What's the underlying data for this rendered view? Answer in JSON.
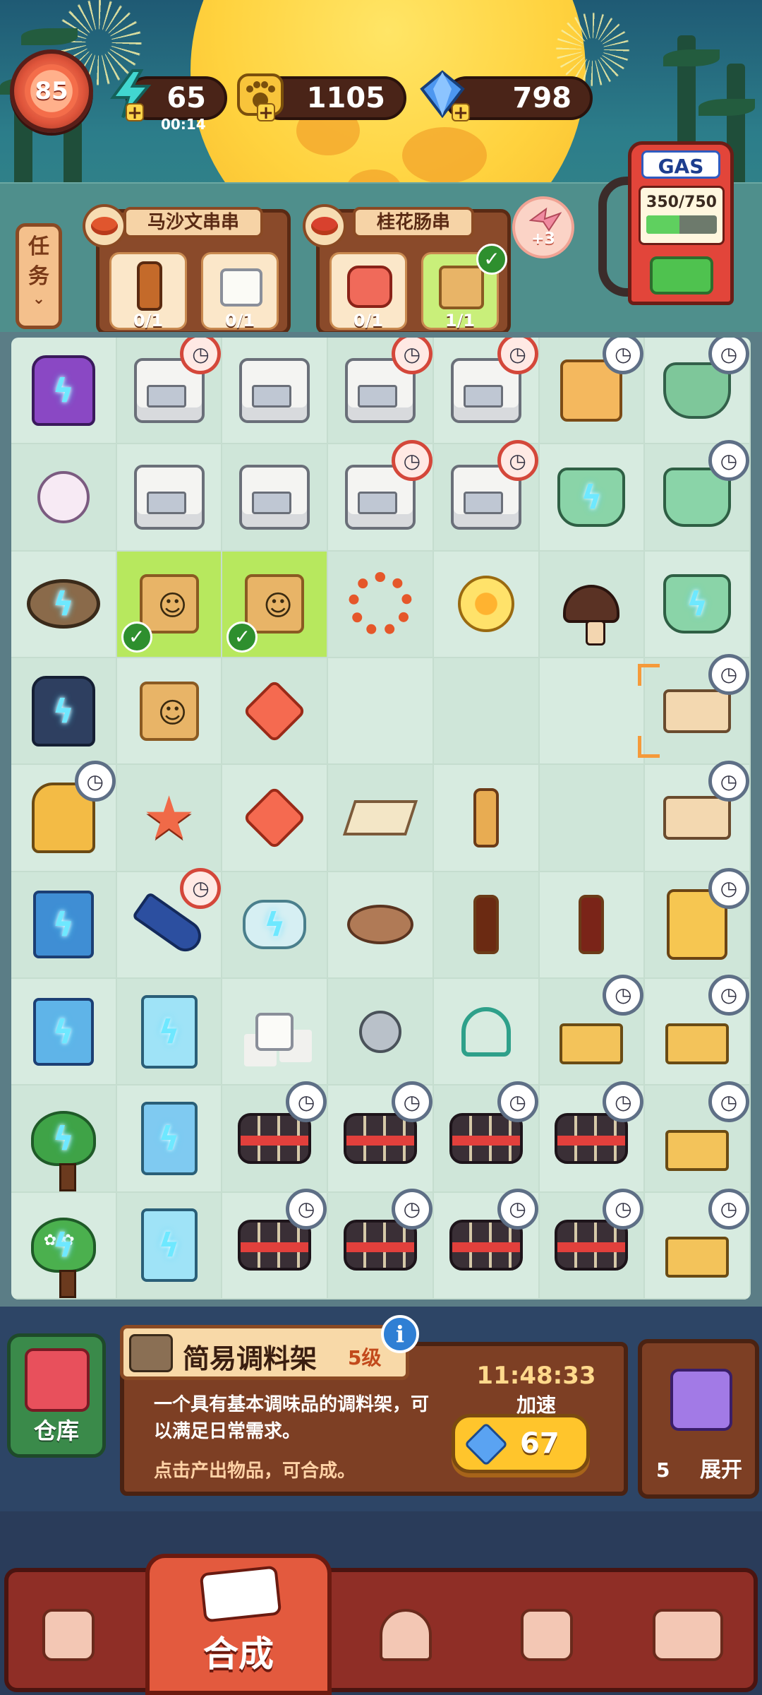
{
  "hud": {
    "level": "85",
    "energy": "65",
    "energy_timer": "00:14",
    "coins": "1105",
    "gems": "798"
  },
  "gas": {
    "label": "GAS",
    "value": "350/750",
    "fill_fraction": 0.4667
  },
  "task_tab": {
    "label": "任务"
  },
  "orders": [
    {
      "title": "马沙文串串",
      "slots": [
        {
          "icon": "sauce-bottle",
          "count": "0/1",
          "done": false
        },
        {
          "icon": "sugar-cube",
          "count": "0/1",
          "done": false
        }
      ]
    },
    {
      "title": "桂花肠串",
      "slots": [
        {
          "icon": "raw-meat",
          "count": "0/1",
          "done": false
        },
        {
          "icon": "takeout-bag",
          "count": "1/1",
          "done": true
        }
      ]
    }
  ],
  "reward": {
    "label": "+3"
  },
  "board": [
    [
      {
        "k": "bag2",
        "n": "purple-bag-generator",
        "bolt": true
      },
      {
        "k": "oven",
        "clock": "red"
      },
      {
        "k": "oven"
      },
      {
        "k": "oven",
        "clock": "red"
      },
      {
        "k": "oven",
        "clock": "red"
      },
      {
        "k": "box3",
        "n": "snack-box",
        "clock": "blue"
      },
      {
        "k": "pot",
        "n": "hotpot",
        "clock": "blue"
      }
    ],
    [
      {
        "k": "egg",
        "n": "porcelain-egg"
      },
      {
        "k": "oven",
        "n": "oven-highlighted"
      },
      {
        "k": "oven"
      },
      {
        "k": "oven",
        "clock": "red"
      },
      {
        "k": "oven",
        "clock": "red"
      },
      {
        "k": "fryer",
        "n": "skewer-fryer",
        "bolt": true
      },
      {
        "k": "fryer",
        "n": "skewer-fryer-2",
        "clock": "blue"
      }
    ],
    [
      {
        "k": "bowl",
        "n": "bowl-generator",
        "bolt": true
      },
      {
        "k": "bag",
        "n": "takeout-bag",
        "lit": true,
        "ok": true
      },
      {
        "k": "bag",
        "n": "takeout-bag",
        "lit": true,
        "ok": true
      },
      {
        "k": "leafring",
        "n": "maple-wreath"
      },
      {
        "k": "flowerY",
        "n": "osmanthus-flower"
      },
      {
        "k": "mushroom",
        "n": "shiitake-mushroom"
      },
      {
        "k": "fryer",
        "n": "skewer-cart",
        "bolt": true
      }
    ],
    [
      {
        "k": "bag3",
        "n": "dark-bag-generator",
        "bolt": true
      },
      {
        "k": "bag",
        "n": "small-takeout-bag"
      },
      {
        "k": "diamond4",
        "n": "red-crystal"
      },
      {
        "k": "empty"
      },
      {
        "k": "empty"
      },
      {
        "k": "empty"
      },
      {
        "k": "shelf",
        "n": "seasoning-rack",
        "clock": "blue",
        "sel": true
      }
    ],
    [
      {
        "k": "bag4",
        "n": "yellow-bag-generator",
        "clock": "blue"
      },
      {
        "k": "star",
        "n": "red-star"
      },
      {
        "k": "diamond4",
        "n": "red-gem-small"
      },
      {
        "k": "tray",
        "n": "rice-tray"
      },
      {
        "k": "bottle",
        "n": "sauce-bottle"
      },
      {
        "k": "empty"
      },
      {
        "k": "shelf",
        "n": "seasoning-rack-2",
        "clock": "blue"
      }
    ],
    [
      {
        "k": "book",
        "n": "recipe-book",
        "bolt": true
      },
      {
        "k": "horn",
        "n": "star-horn",
        "clock": "red"
      },
      {
        "k": "tshirt",
        "n": "towel-roll",
        "bolt": true
      },
      {
        "k": "cookie",
        "n": "pepper-cookie"
      },
      {
        "k": "bottle",
        "n": "chili-jar",
        "v": "dark"
      },
      {
        "k": "bottle",
        "n": "soy-sauce-bottle",
        "v": "red"
      },
      {
        "k": "vending",
        "n": "vending-machine",
        "clock": "blue"
      }
    ],
    [
      {
        "k": "book",
        "n": "gold-book",
        "bolt": true,
        "alt": true
      },
      {
        "k": "fridge",
        "n": "ice-cabinet",
        "bolt": true
      },
      {
        "k": "cube",
        "n": "sugar-cubes"
      },
      {
        "k": "screw",
        "n": "screw"
      },
      {
        "k": "scissors",
        "n": "scissors"
      },
      {
        "k": "drone",
        "n": "delivery-drone",
        "clock": "blue"
      },
      {
        "k": "drone",
        "n": "delivery-drone-2",
        "clock": "blue"
      }
    ],
    [
      {
        "k": "tree",
        "n": "leaf-tree",
        "bolt": true
      },
      {
        "k": "fridge",
        "n": "open-cabinet",
        "bolt": true,
        "v": "open"
      },
      {
        "k": "logs",
        "n": "log-bundle",
        "clock": "blue"
      },
      {
        "k": "logs",
        "n": "log-bundle",
        "clock": "blue"
      },
      {
        "k": "logs",
        "n": "log-bundle",
        "clock": "blue"
      },
      {
        "k": "logs",
        "n": "log-bundle",
        "clock": "blue"
      },
      {
        "k": "drone",
        "n": "delivery-drone-3",
        "clock": "blue"
      }
    ],
    [
      {
        "k": "tree",
        "n": "flower-tree",
        "bolt": true,
        "v": "flower"
      },
      {
        "k": "fridge",
        "n": "freezer",
        "bolt": true
      },
      {
        "k": "logs",
        "n": "log-bundle",
        "clock": "blue"
      },
      {
        "k": "logs",
        "n": "log-bundle",
        "clock": "blue"
      },
      {
        "k": "logs",
        "n": "log-bundle",
        "clock": "blue"
      },
      {
        "k": "logs",
        "n": "log-bundle",
        "clock": "blue"
      },
      {
        "k": "drone",
        "n": "delivery-drone-4",
        "clock": "blue"
      }
    ]
  ],
  "warehouse": {
    "label": "仓库"
  },
  "selected": {
    "name": "简易调料架",
    "level": "5级",
    "description": "一个具有基本调味品的调料架，可以满足日常需求。",
    "hint": "点击产出物品，可合成。",
    "countdown": "11:48:33",
    "speedup_label": "加速",
    "speedup_cost": "67"
  },
  "expand": {
    "count": "5",
    "label": "展开"
  },
  "nav": {
    "active_label": "合成"
  }
}
